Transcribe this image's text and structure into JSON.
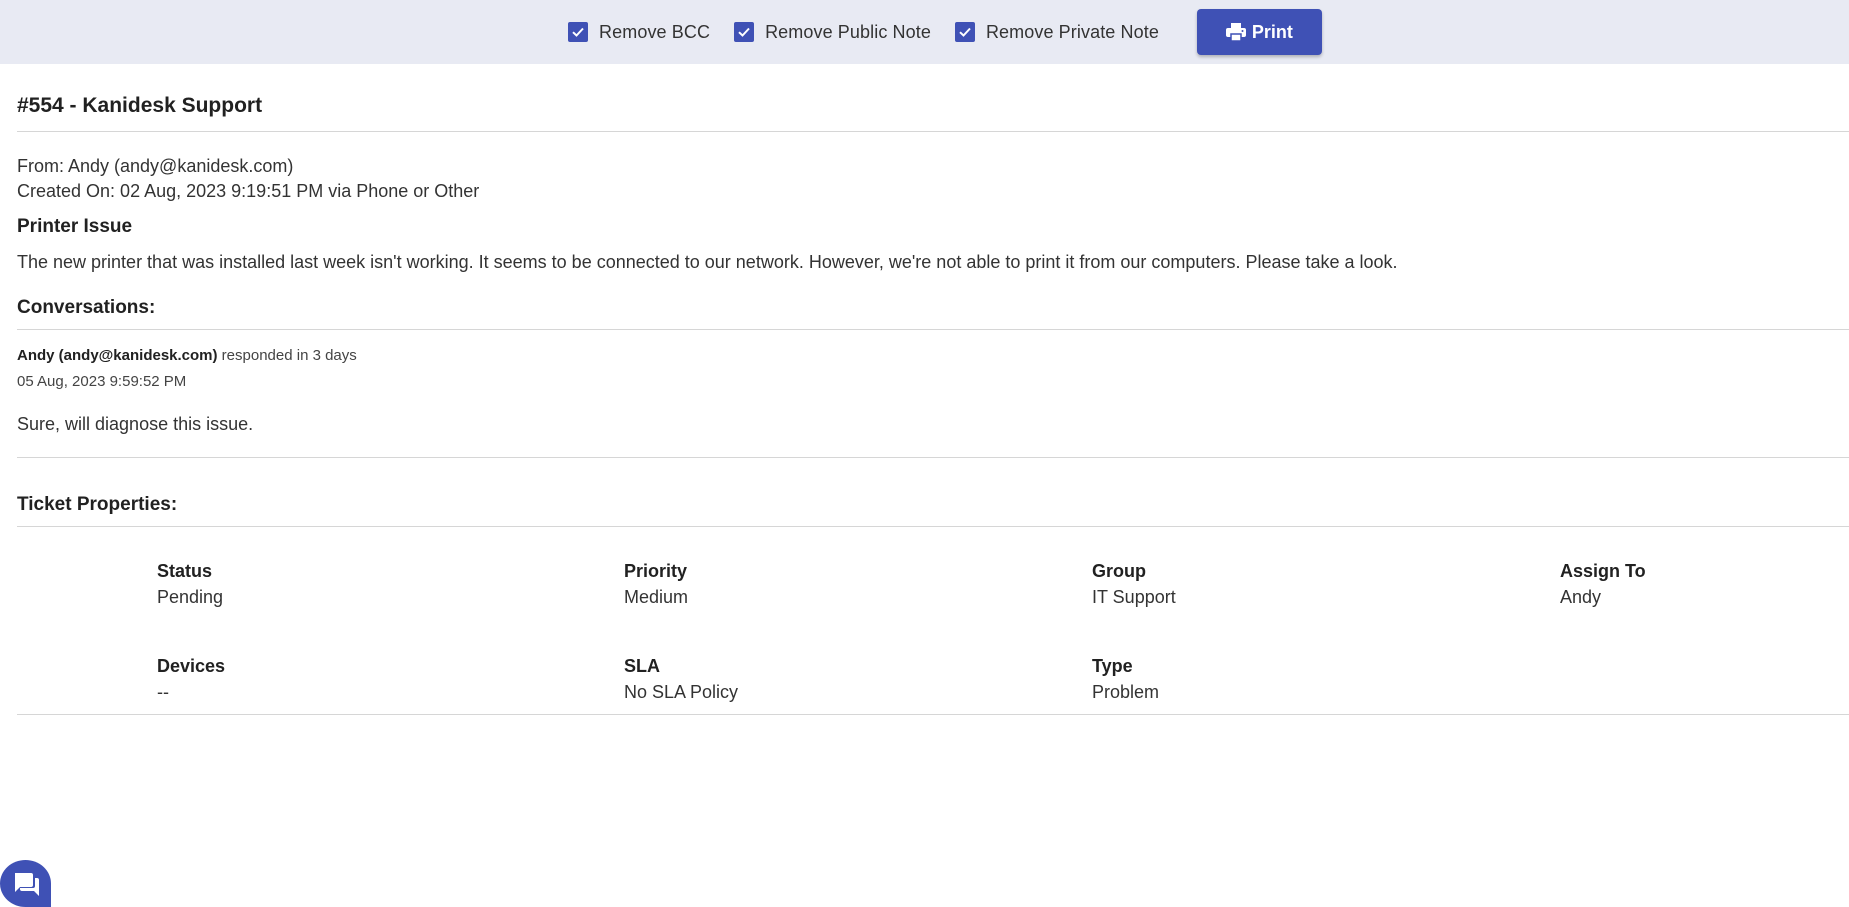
{
  "toolbar": {
    "checkboxes": [
      {
        "label": "Remove BCC",
        "checked": true
      },
      {
        "label": "Remove Public Note",
        "checked": true
      },
      {
        "label": "Remove Private Note",
        "checked": true
      }
    ],
    "print_label": "Print",
    "accent_color": "#3f51b5",
    "background_color": "#e8eaf3"
  },
  "ticket": {
    "title": "#554 - Kanidesk Support",
    "from": "From: Andy (andy@kanidesk.com)",
    "created": "Created On: 02 Aug, 2023 9:19:51 PM via Phone or Other",
    "subject": "Printer Issue",
    "description": "The new printer that was installed last week isn't working. It seems to be connected to our network. However, we're not able to print it from our computers. Please take a look."
  },
  "conversations": {
    "heading": "Conversations:",
    "items": [
      {
        "author": "Andy (andy@kanidesk.com)",
        "action": " responded in 3 days",
        "date": "05 Aug, 2023 9:59:52 PM",
        "body": "Sure, will diagnose this issue."
      }
    ]
  },
  "properties": {
    "heading": "Ticket Properties:",
    "items": [
      {
        "label": "Status",
        "value": "Pending"
      },
      {
        "label": "Priority",
        "value": "Medium"
      },
      {
        "label": "Group",
        "value": "IT Support"
      },
      {
        "label": "Assign To",
        "value": "Andy"
      },
      {
        "label": "Devices",
        "value": "--"
      },
      {
        "label": "SLA",
        "value": "No SLA Policy"
      },
      {
        "label": "Type",
        "value": "Problem"
      }
    ]
  },
  "chat": {
    "icon": "chat-bubble-icon"
  }
}
